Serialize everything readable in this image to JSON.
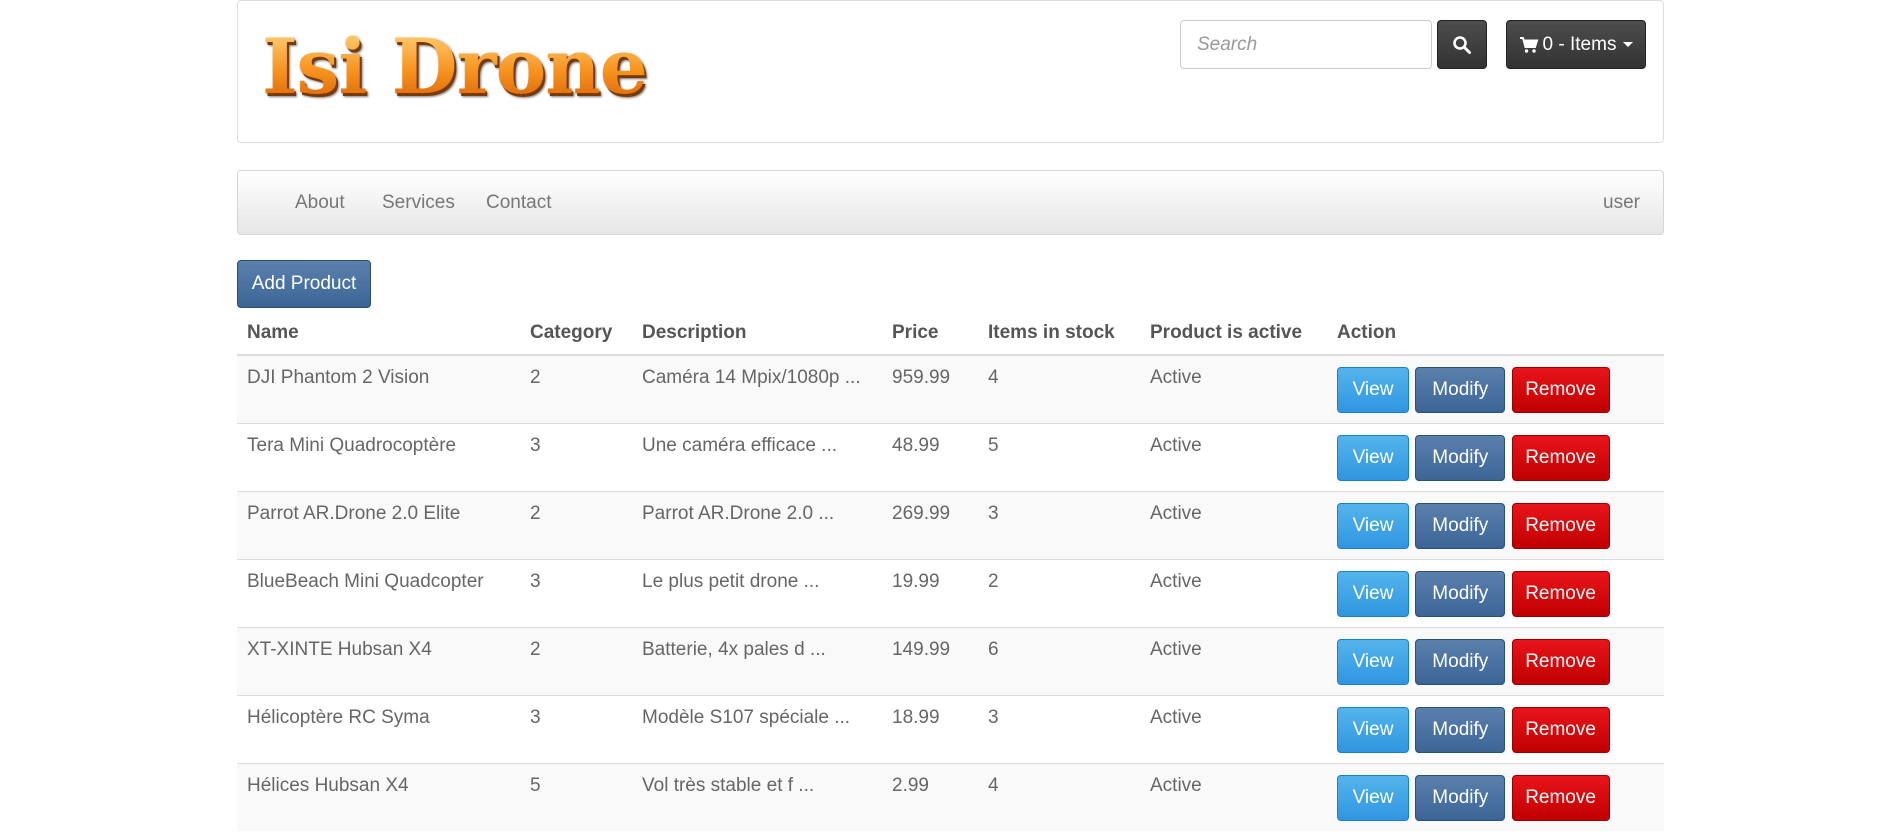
{
  "header": {
    "logo_text": "Isi Drone",
    "search": {
      "placeholder": "Search",
      "value": ""
    },
    "search_button_icon": "search-icon",
    "cart": {
      "icon": "shopping-cart-icon",
      "label": "0 - Items"
    }
  },
  "navbar": {
    "items": [
      {
        "label": "About"
      },
      {
        "label": "Services"
      },
      {
        "label": "Contact"
      }
    ],
    "user_label": "user"
  },
  "actions": {
    "add_product_label": "Add Product"
  },
  "table": {
    "headers": {
      "name": "Name",
      "category": "Category",
      "description": "Description",
      "price": "Price",
      "stock": "Items in stock",
      "active": "Product is active",
      "action": "Action"
    },
    "button_labels": {
      "view": "View",
      "modify": "Modify",
      "remove": "Remove"
    },
    "rows": [
      {
        "name": "DJI Phantom 2 Vision",
        "category": "2",
        "description": "Caméra 14 Mpix/1080p ...",
        "price": "959.99",
        "stock": "4",
        "active": "Active"
      },
      {
        "name": "Tera Mini Quadrocoptère",
        "category": "3",
        "description": "Une caméra efficace ...",
        "price": "48.99",
        "stock": "5",
        "active": "Active"
      },
      {
        "name": "Parrot AR.Drone 2.0 Elite",
        "category": "2",
        "description": "Parrot AR.Drone 2.0 ...",
        "price": "269.99",
        "stock": "3",
        "active": "Active"
      },
      {
        "name": "BlueBeach Mini Quadcopter",
        "category": "3",
        "description": "Le plus petit drone ...",
        "price": "19.99",
        "stock": "2",
        "active": "Active"
      },
      {
        "name": "XT-XINTE Hubsan X4",
        "category": "2",
        "description": "Batterie, 4x pales d ...",
        "price": "149.99",
        "stock": "6",
        "active": "Active"
      },
      {
        "name": "Hélicoptère RC Syma",
        "category": "3",
        "description": "Modèle S107 spéciale ...",
        "price": "18.99",
        "stock": "3",
        "active": "Active"
      },
      {
        "name": "Hélices Hubsan X4",
        "category": "5",
        "description": "Vol très stable et f ...",
        "price": "2.99",
        "stock": "4",
        "active": "Active"
      }
    ]
  },
  "colors": {
    "view_button": "#2f96e0",
    "modify_button": "#3c6597",
    "remove_button": "#c00000",
    "dark_button": "#333333",
    "logo_orange": "#f7931e"
  }
}
